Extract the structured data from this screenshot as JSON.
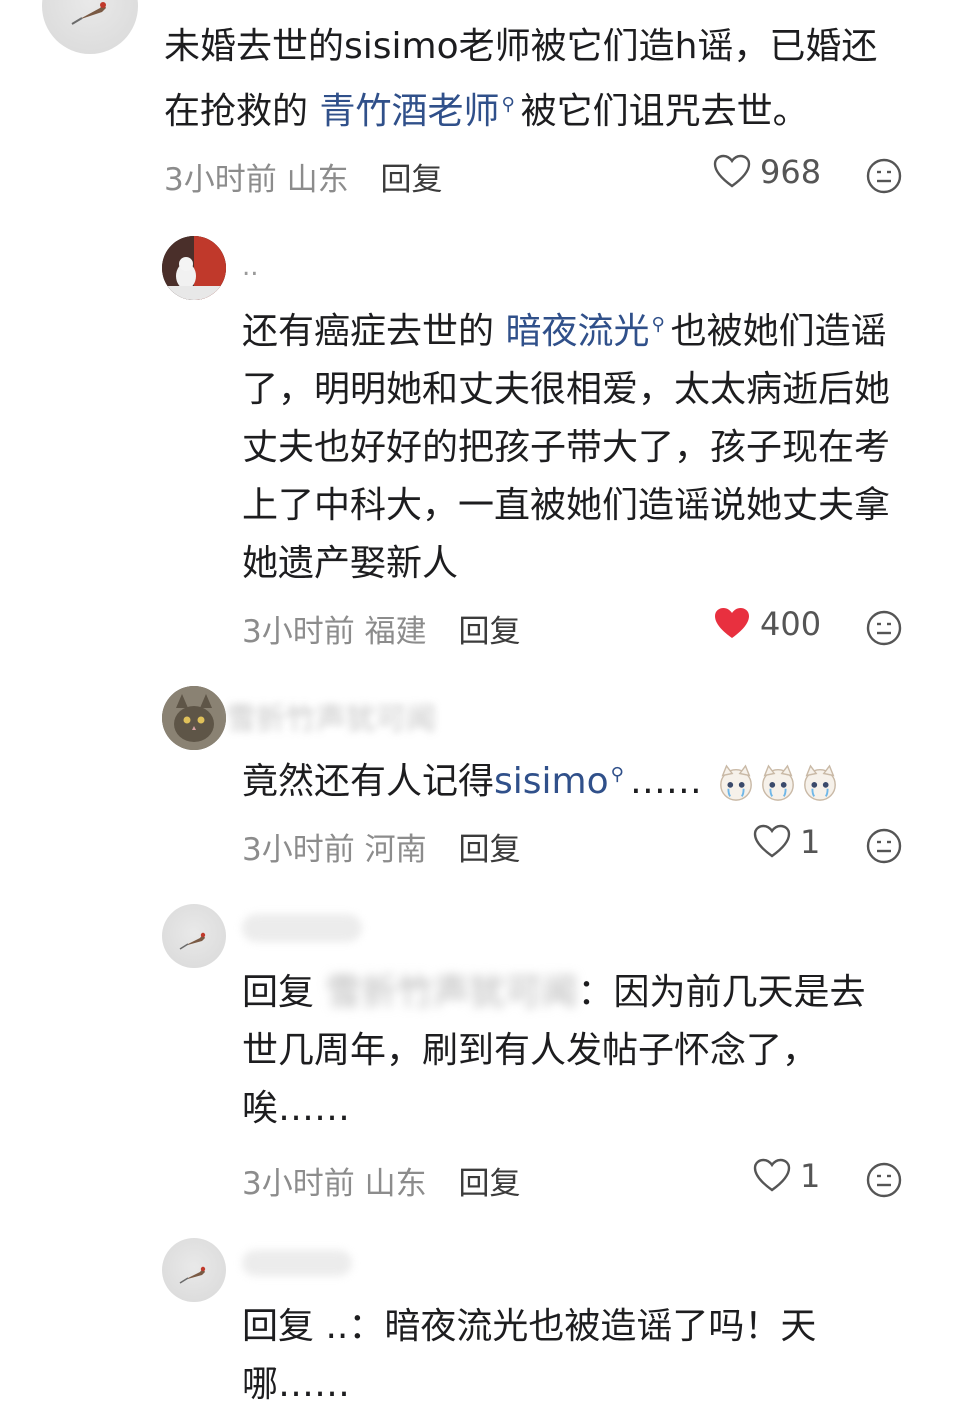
{
  "comments": [
    {
      "id": "c1",
      "username": "",
      "lines": [
        "未婚去世的sisimo老师被它们造h谣，已婚还",
        ""
      ],
      "line2_prefix": "在抢救的 ",
      "line2_link": "青竹酒老师",
      "line2_suffix": "被它们诅咒去世。",
      "time": "3小时前",
      "location": "山东",
      "reply_label": "回复",
      "likes": "968",
      "liked": false
    },
    {
      "id": "c2",
      "username": "..",
      "line1_prefix": "还有癌症去世的 ",
      "line1_link": "暗夜流光",
      "line1_suffix": "也被她们造谣",
      "lines": [
        "了，明明她和丈夫很相爱，太太病逝后她",
        "丈夫也好好的把孩子带大了，孩子现在考",
        "上了中科大，一直被她们造谣说她丈夫拿",
        "她遗产娶新人"
      ],
      "time": "3小时前",
      "location": "福建",
      "reply_label": "回复",
      "likes": "400",
      "liked": true
    },
    {
      "id": "c3",
      "username": "雪折竹声犹可闻",
      "prefix": "竟然还有人记得",
      "link": "sisimo",
      "suffix": "……",
      "time": "3小时前",
      "location": "河南",
      "reply_label": "回复",
      "likes": "1",
      "liked": false
    },
    {
      "id": "c4",
      "username": "",
      "reply_prefix": "回复",
      "reply_target": "雪折竹声犹可闻",
      "line1_suffix": "：因为前几天是去",
      "lines": [
        "世几周年，刷到有人发帖子怀念了，",
        "唉……"
      ],
      "time": "3小时前",
      "location": "山东",
      "reply_label": "回复",
      "likes": "1",
      "liked": false
    },
    {
      "id": "c5",
      "username": "",
      "reply_prefix": "回复",
      "reply_target": "..",
      "line1_suffix": "：暗夜流光也被造谣了吗！天",
      "lines": [
        "哪……"
      ]
    }
  ],
  "colors": {
    "link": "#30508a",
    "meta": "#8c8c8c",
    "liked_heart": "#e8303f"
  },
  "icons": {
    "heart": "heart-icon",
    "emoji": "emoji-icon",
    "search": "search-icon"
  }
}
